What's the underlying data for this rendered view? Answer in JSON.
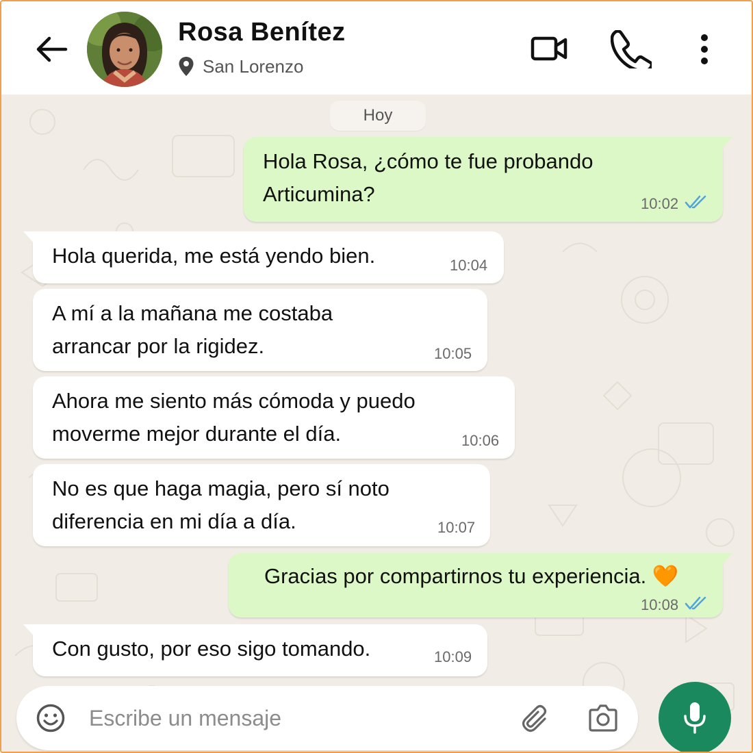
{
  "colors": {
    "accent_green": "#1a8a5e",
    "outgoing_bubble": "#dcf8c6",
    "incoming_bubble": "#ffffff",
    "read_ticks": "#4fa3e0",
    "frame_border": "#f0a04b"
  },
  "header": {
    "contact_name": "Rosa Benítez",
    "location": "San Lorenzo",
    "icons": [
      "back-arrow-icon",
      "avatar",
      "location-pin-icon",
      "video-call-icon",
      "phone-call-icon",
      "more-options-icon"
    ]
  },
  "chat": {
    "date_chip": "Hoy",
    "messages": [
      {
        "direction": "out",
        "lines": [
          "Hola Rosa, ¿cómo te fue probando",
          "Articumina?"
        ],
        "time": "10:02",
        "status": "read"
      },
      {
        "direction": "in",
        "lines": [
          "Hola querida, me está yendo bien."
        ],
        "time": "10:04"
      },
      {
        "direction": "in",
        "lines": [
          "A mí a la mañana me costaba",
          "arrancar por la rigidez."
        ],
        "time": "10:05"
      },
      {
        "direction": "in",
        "lines": [
          "Ahora me siento más cómoda y puedo",
          "moverme mejor durante el día."
        ],
        "time": "10:06"
      },
      {
        "direction": "in",
        "lines": [
          "No es que haga magia, pero sí noto",
          "diferencia en mi día a día."
        ],
        "time": "10:07"
      },
      {
        "direction": "out",
        "lines": [
          "Gracias por compartirnos tu experiencia. 🧡"
        ],
        "time": "10:08",
        "status": "read"
      },
      {
        "direction": "in",
        "lines": [
          "Con gusto, por eso sigo tomando."
        ],
        "time": "10:09"
      }
    ]
  },
  "composer": {
    "placeholder": "Escribe un mensaje",
    "value": "",
    "icons": [
      "emoji-icon",
      "attach-icon",
      "camera-icon",
      "microphone-icon"
    ]
  }
}
